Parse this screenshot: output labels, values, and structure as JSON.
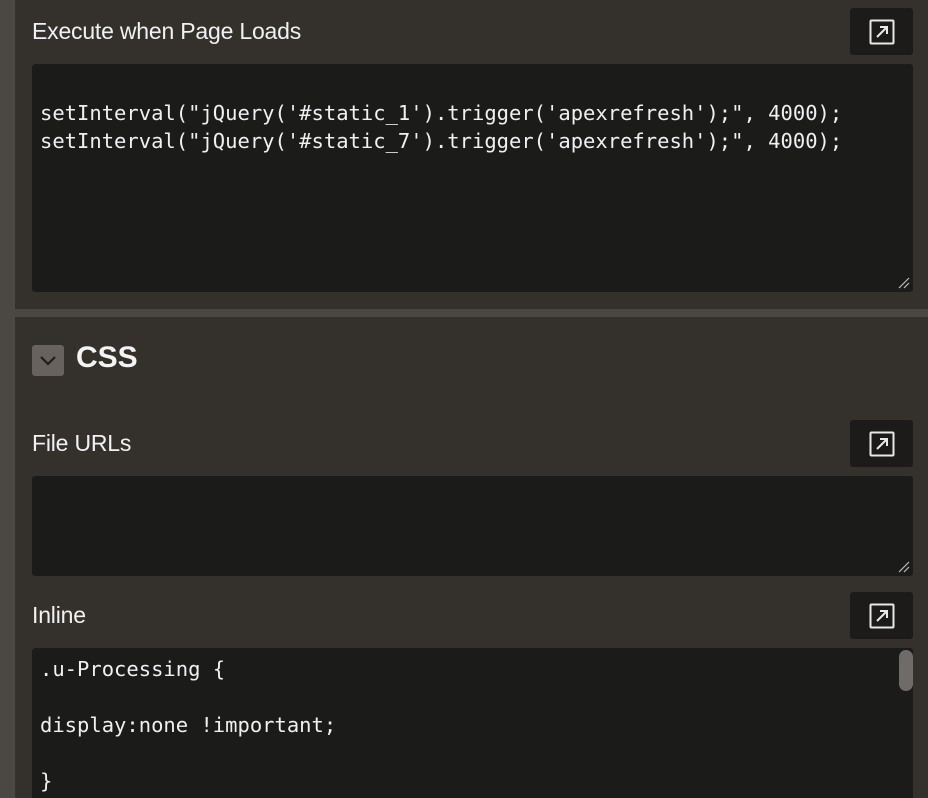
{
  "page_load": {
    "label": "Execute when Page Loads",
    "code_lines": [
      "setInterval(\"jQuery('#static_1').trigger('apexrefresh');\", 4000);",
      "setInterval(\"jQuery('#static_7').trigger('apexrefresh');\", 4000);"
    ]
  },
  "css_section": {
    "title": "CSS",
    "file_urls": {
      "label": "File URLs",
      "value": ""
    },
    "inline": {
      "label": "Inline",
      "code_lines": [
        ".u-Processing {",
        "",
        "display:none !important;",
        "",
        "}"
      ]
    }
  },
  "icons": {
    "expand": "expand-arrow-icon",
    "toggle": "chevron-down-icon",
    "resize": "resize-grip-icon"
  },
  "colors": {
    "background": "#34312d",
    "editor_background": "#1b1b1a",
    "button_background": "#1c1b1a",
    "toggle_background": "#67625d",
    "text": "#f2f2f2"
  }
}
